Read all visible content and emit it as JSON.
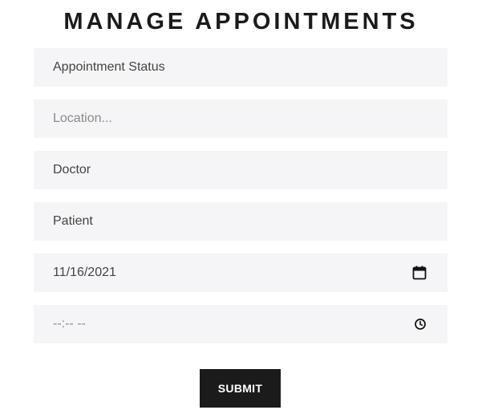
{
  "page_title": "MANAGE APPOINTMENTS",
  "form": {
    "status_value": "Appointment Status",
    "location_placeholder": "Location...",
    "doctor_value": "Doctor",
    "patient_value": "Patient",
    "date_value": "11/16/2021",
    "time_placeholder": "--:-- --",
    "submit_label": "SUBMIT"
  },
  "icons": {
    "date": "calendar-icon",
    "time": "clock-icon"
  },
  "colors": {
    "title": "#1b1b1b",
    "field_bg": "#f5f5f7",
    "button_bg": "#1b1b1b",
    "button_text": "#ffffff"
  }
}
